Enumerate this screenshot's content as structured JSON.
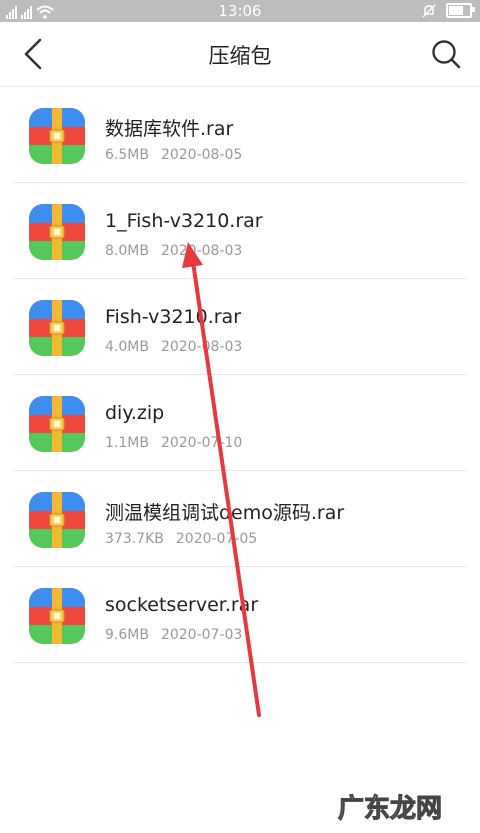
{
  "status_bar": {
    "time": "13:06",
    "icons": [
      "signal-icon",
      "signal-icon",
      "wifi-icon",
      "mute-icon",
      "battery-icon"
    ]
  },
  "header": {
    "title": "压缩包",
    "back_icon": "back-chevron-icon",
    "search_icon": "search-icon"
  },
  "files": [
    {
      "name": "数据库软件.rar",
      "size": "6.5MB",
      "date": "2020-08-05",
      "icon": "archive-icon"
    },
    {
      "name": "1_Fish-v3210.rar",
      "size": "8.0MB",
      "date": "2020-08-03",
      "icon": "archive-icon"
    },
    {
      "name": "Fish-v3210.rar",
      "size": "4.0MB",
      "date": "2020-08-03",
      "icon": "archive-icon"
    },
    {
      "name": "diy.zip",
      "size": "1.1MB",
      "date": "2020-07-10",
      "icon": "archive-icon"
    },
    {
      "name": "测温模组调试demo源码.rar",
      "size": "373.7KB",
      "date": "2020-07-05",
      "icon": "archive-icon"
    },
    {
      "name": "socketserver.rar",
      "size": "9.6MB",
      "date": "2020-07-03",
      "icon": "archive-icon"
    }
  ],
  "colors": {
    "icon_blue": "#3d8ef0",
    "icon_red": "#f0483c",
    "icon_green": "#54c85a",
    "icon_strap": "#f2b830",
    "arrow": "#e8383f"
  },
  "watermark": {
    "text": "广东龙网"
  }
}
